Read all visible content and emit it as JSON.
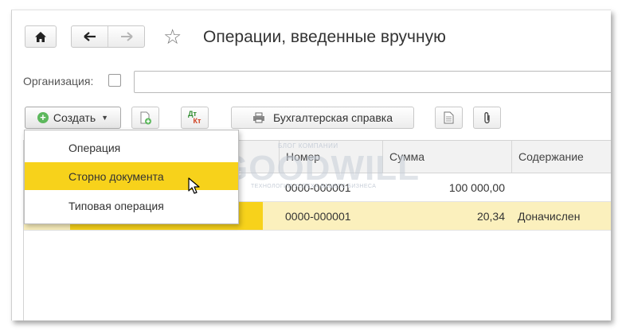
{
  "window": {
    "title": "Операции, введенные вручную"
  },
  "filter": {
    "organization_label": "Организация:",
    "organization_value": ""
  },
  "toolbar": {
    "create_label": "Создать",
    "dt_label": "Дт",
    "kt_label": "Кт",
    "report_label": "Бухгалтерская справка"
  },
  "create_menu": {
    "items": [
      {
        "label": "Операция",
        "highlighted": false
      },
      {
        "label": "Сторно документа",
        "highlighted": true
      },
      {
        "label": "Типовая операция",
        "highlighted": false
      }
    ]
  },
  "table": {
    "columns": [
      "Номер",
      "Сумма",
      "Содержание"
    ],
    "rows": [
      {
        "number": "0000-000001",
        "amount": "100 000,00",
        "content": ""
      },
      {
        "number": "0000-000001",
        "amount": "20,34",
        "content": "Доначислен"
      }
    ]
  },
  "watermark": {
    "top": "БЛОГ КОМПАНИИ",
    "main": "GOODWILL",
    "bottom": "ТЕХНОЛОГИИ УСПЕХА ВАШЕГО БИЗНЕСА"
  },
  "colors": {
    "highlight": "#f7d21b",
    "selected_row": "#fbf0bd",
    "accent_green": "#5cb85c"
  }
}
